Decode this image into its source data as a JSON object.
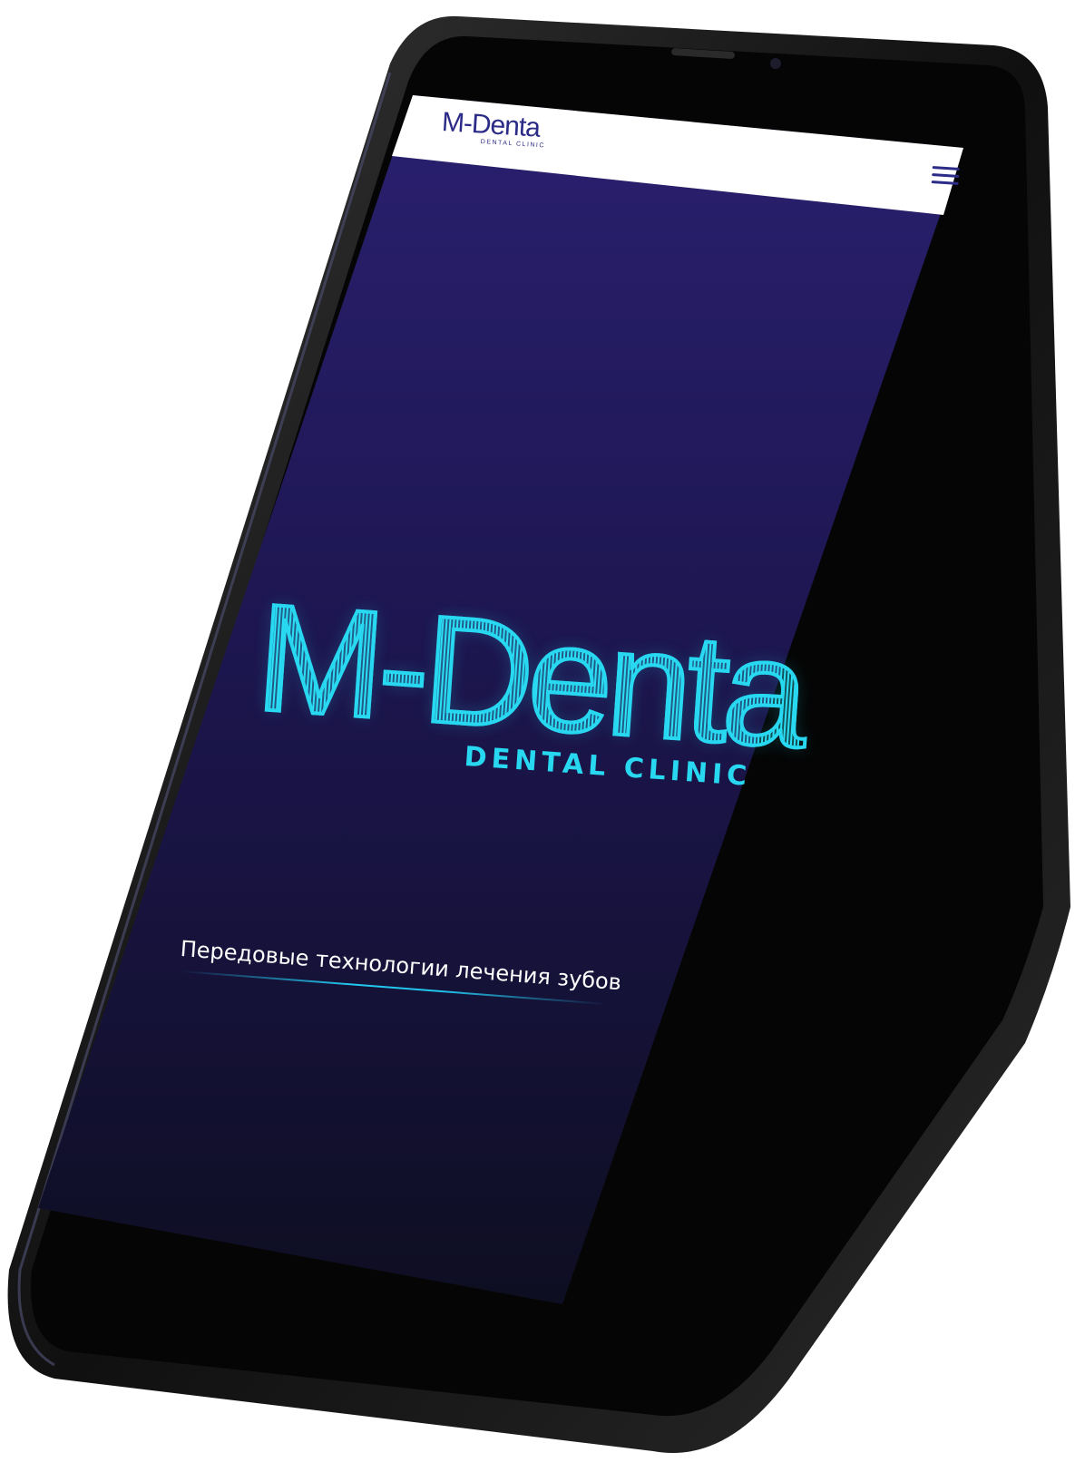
{
  "header": {
    "logo_main": "M-Denta",
    "logo_sub": "DENTAL CLINIC",
    "menu_icon": "hamburger-menu-icon"
  },
  "hero": {
    "logo_main": "M-Denta",
    "logo_sub": "DENTAL CLINIC",
    "tagline": "Передовые технологии лечения зубов"
  },
  "colors": {
    "header_bg": "#ffffff",
    "brand_navy": "#2c2c88",
    "accent_cyan": "#27d8f0",
    "screen_bg_top": "#2a2070",
    "screen_bg_bottom": "#0e0e22",
    "phone_body": "#151515"
  }
}
